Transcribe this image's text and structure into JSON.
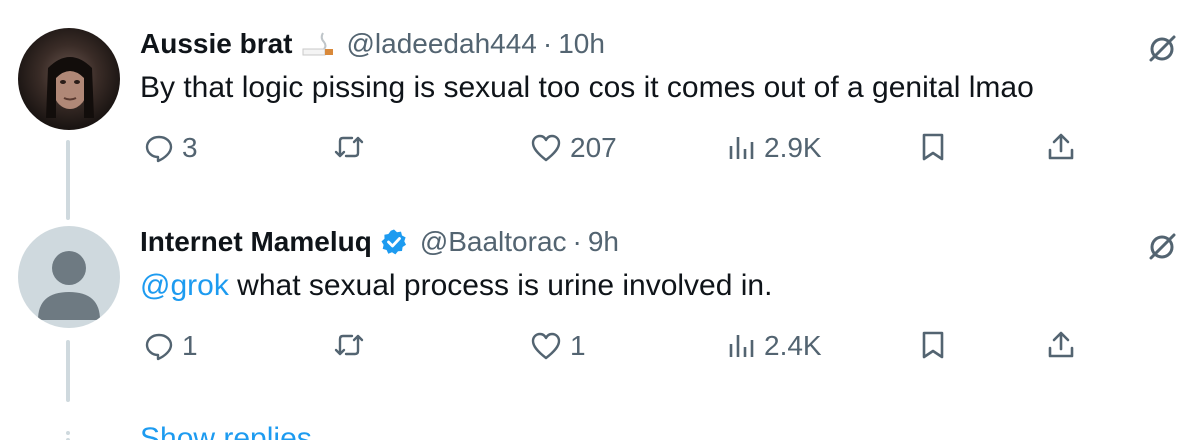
{
  "tweets": [
    {
      "name": "Aussie brat",
      "name_emoji": "cigarette-icon",
      "handle": "@ladeedah444",
      "separator": "·",
      "time": "10h",
      "text": "By that logic pissing is sexual too cos it comes out of a genital lmao",
      "replies": "3",
      "likes": "207",
      "views": "2.9K"
    },
    {
      "name": "Internet Mameluq",
      "verified": true,
      "handle": "@Baaltorac",
      "separator": "·",
      "time": "9h",
      "mention": "@grok",
      "text": " what sexual process is urine involved in.",
      "replies": "1",
      "likes": "1",
      "views": "2.4K"
    }
  ],
  "show_replies": "Show replies",
  "colors": {
    "accent": "#1d9bf0",
    "muted": "#536471",
    "text": "#0f1419",
    "thread": "#cfd9de"
  }
}
